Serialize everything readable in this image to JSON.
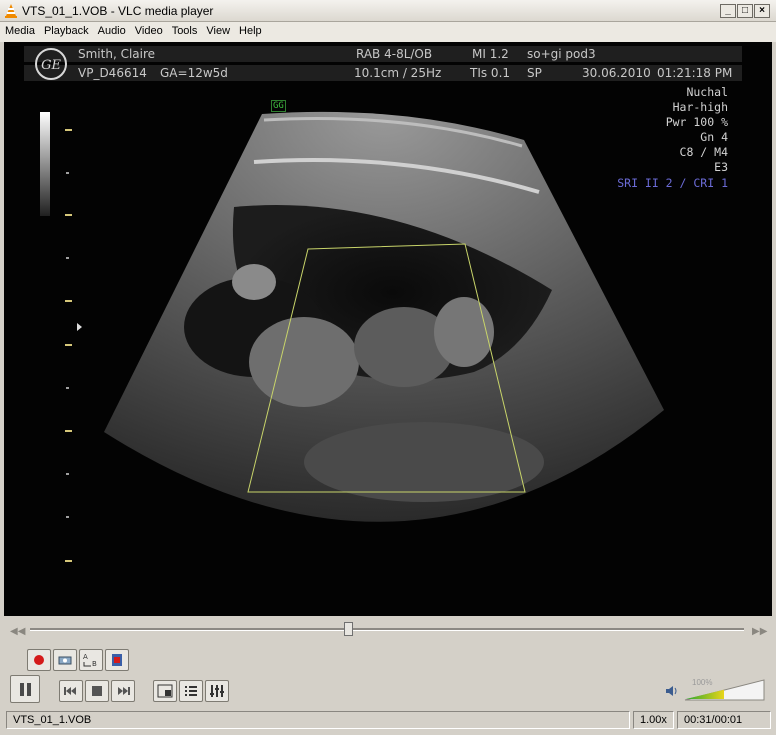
{
  "window": {
    "title": "VTS_01_1.VOB - VLC media player"
  },
  "menu": [
    "Media",
    "Playback",
    "Audio",
    "Video",
    "Tools",
    "View",
    "Help"
  ],
  "ultrasound": {
    "patient_name": "Smith, Claire",
    "patient_id": "VP_D46614",
    "ga": "GA=12w5d",
    "probe": "RAB 4-8L/OB",
    "depth_freq": "10.1cm / 25Hz",
    "mi": "MI  1.2",
    "tis": "TIs  0.1",
    "preset": "so+gi pod3",
    "sp": "SP",
    "date": "30.06.2010",
    "time": "01:21:18 PM",
    "params": [
      "Nuchal",
      "Har-high",
      "Pwr 100 %",
      "Gn  4",
      "C8 / M4",
      "E3"
    ],
    "sri": "SRI II 2 / CRI 1",
    "gg_mark": "GG"
  },
  "controls": {
    "volume_label": "100%",
    "volume_level": 1.0,
    "seek_position": 0.446
  },
  "status": {
    "filename": "VTS_01_1.VOB",
    "speed": "1.00x",
    "time": "00:31/00:01"
  },
  "colors": {
    "sri_text": "#6b6bd6",
    "volume_low": "#2fa82f",
    "volume_high": "#e8d51a",
    "record": "#d41a1a"
  }
}
